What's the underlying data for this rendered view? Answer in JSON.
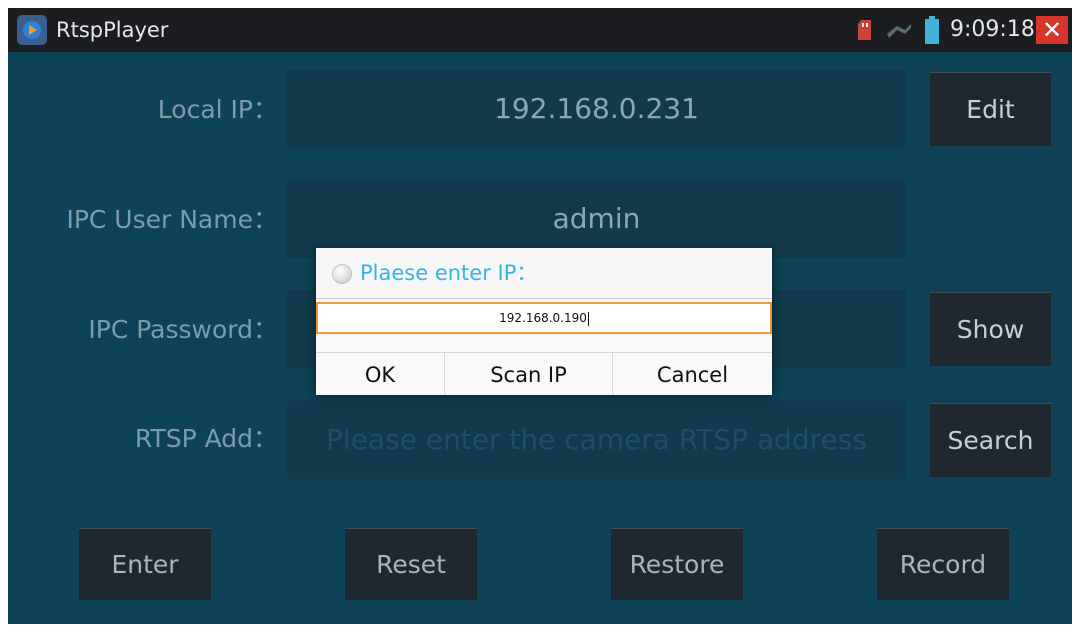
{
  "app": {
    "title": "RtspPlayer",
    "time": "9:09:18",
    "close_glyph": "✕"
  },
  "form": {
    "local_ip_label": "Local IP：",
    "local_ip_value": "192.168.0.231",
    "user_name_label": "IPC User Name：",
    "user_name_value": "admin",
    "password_label": "IPC Password：",
    "rtsp_label": "RTSP Add：",
    "rtsp_placeholder": "Please enter the camera RTSP address"
  },
  "side_buttons": {
    "edit": "Edit",
    "show": "Show",
    "search": "Search"
  },
  "bottom_buttons": {
    "enter": "Enter",
    "reset": "Reset",
    "restore": "Restore",
    "record": "Record"
  },
  "dialog": {
    "title": "Plaese enter IP：",
    "input_value": "192.168.0.190",
    "ok": "OK",
    "scan_ip": "Scan IP",
    "cancel": "Cancel"
  },
  "colors": {
    "background": "#0d4257",
    "titlebar": "#1b1d21",
    "dialog_title": "#33b5e5",
    "input_focus_border": "#f09a3e",
    "close_button": "#d8352d"
  },
  "icons": {
    "app": "player-app-icon",
    "status": [
      "sd-card-icon",
      "network-icon",
      "battery-icon"
    ],
    "close": "close-icon",
    "dialog": "info-icon"
  }
}
